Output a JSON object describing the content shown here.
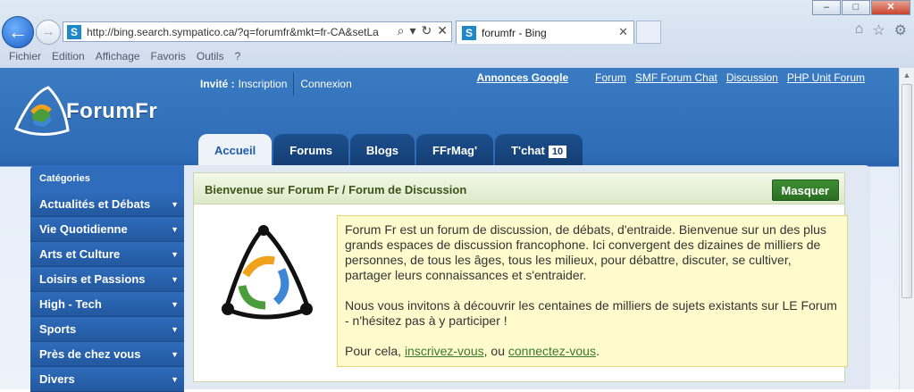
{
  "browser": {
    "address": "http://bing.search.sympatico.ca/?q=forumfr&mkt=fr-CA&setLa",
    "site_badge": "S",
    "tab_title": "forumfr - Bing",
    "menu": [
      "Fichier",
      "Edition",
      "Affichage",
      "Favoris",
      "Outils",
      "?"
    ],
    "window_buttons": {
      "minimize": "–",
      "maximize": "□",
      "close": "✕"
    }
  },
  "header": {
    "guest_label": "Invité :",
    "register": "Inscription",
    "login": "Connexion",
    "links": [
      "Annonces Google",
      "Forum",
      "SMF Forum Chat",
      "Discussion",
      "PHP Unit Forum"
    ],
    "logo_text": "ForumFr"
  },
  "tabs": [
    {
      "label": "Accueil",
      "active": true
    },
    {
      "label": "Forums"
    },
    {
      "label": "Blogs"
    },
    {
      "label": "FFrMag'"
    },
    {
      "label": "T'chat",
      "count": "10"
    }
  ],
  "sidebar": {
    "title": "Catégories",
    "items": [
      "Actualités et Débats",
      "Vie Quotidienne",
      "Arts et Culture",
      "Loisirs et Passions",
      "High - Tech",
      "Sports",
      "Près de chez vous",
      "Divers"
    ]
  },
  "welcome": {
    "title": "Bienvenue sur Forum Fr / Forum de Discussion",
    "hide_button": "Masquer",
    "para1": "Forum Fr est un forum de discussion, de débats, d'entraide. Bienvenue sur un des plus grands espaces de discussion francophone. Ici convergent des dizaines de milliers de personnes, de tous les âges, tous les milieux, pour débattre, discuter, se cultiver, partager leurs connaissances et s'entraider.",
    "para2": "Nous vous invitons à découvrir les centaines de milliers de sujets existants sur LE Forum - n'hésitez pas à y participer !",
    "para3_prefix": "Pour cela, ",
    "link_register": "inscrivez-vous",
    "para3_mid": ", ou ",
    "link_login": "connectez-vous",
    "para3_suffix": "."
  }
}
